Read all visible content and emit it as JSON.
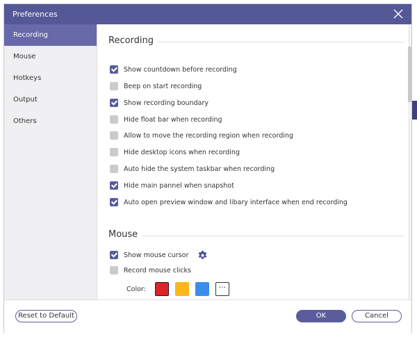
{
  "window": {
    "title": "Preferences"
  },
  "sidebar": {
    "items": [
      {
        "label": "Recording",
        "active": true
      },
      {
        "label": "Mouse",
        "active": false
      },
      {
        "label": "Hotkeys",
        "active": false
      },
      {
        "label": "Output",
        "active": false
      },
      {
        "label": "Others",
        "active": false
      }
    ]
  },
  "recording": {
    "heading": "Recording",
    "options": [
      {
        "label": "Show countdown before recording",
        "checked": true
      },
      {
        "label": "Beep on start recording",
        "checked": false
      },
      {
        "label": "Show recording boundary",
        "checked": true
      },
      {
        "label": "Hide float bar when recording",
        "checked": false
      },
      {
        "label": "Allow to move the recording region when recording",
        "checked": false
      },
      {
        "label": "Hide desktop icons when recording",
        "checked": false
      },
      {
        "label": "Auto hide the system taskbar when recording",
        "checked": false
      },
      {
        "label": "Hide main pannel when snapshot",
        "checked": true
      },
      {
        "label": "Auto open preview window and libary interface when end recording",
        "checked": true
      }
    ]
  },
  "mouse": {
    "heading": "Mouse",
    "show_cursor": {
      "label": "Show mouse cursor",
      "checked": true
    },
    "record_clicks": {
      "label": "Record mouse clicks",
      "checked": false
    },
    "color_label": "Color:",
    "colors": [
      "#e0232b",
      "#fbb619",
      "#3a8de8"
    ],
    "more_label": "···"
  },
  "footer": {
    "reset_label": "Reset to Default",
    "ok_label": "OK",
    "cancel_label": "Cancel"
  },
  "theme": {
    "accent": "#5a5c9c",
    "titlebar": "#545897",
    "active_nav": "#6769a8"
  }
}
